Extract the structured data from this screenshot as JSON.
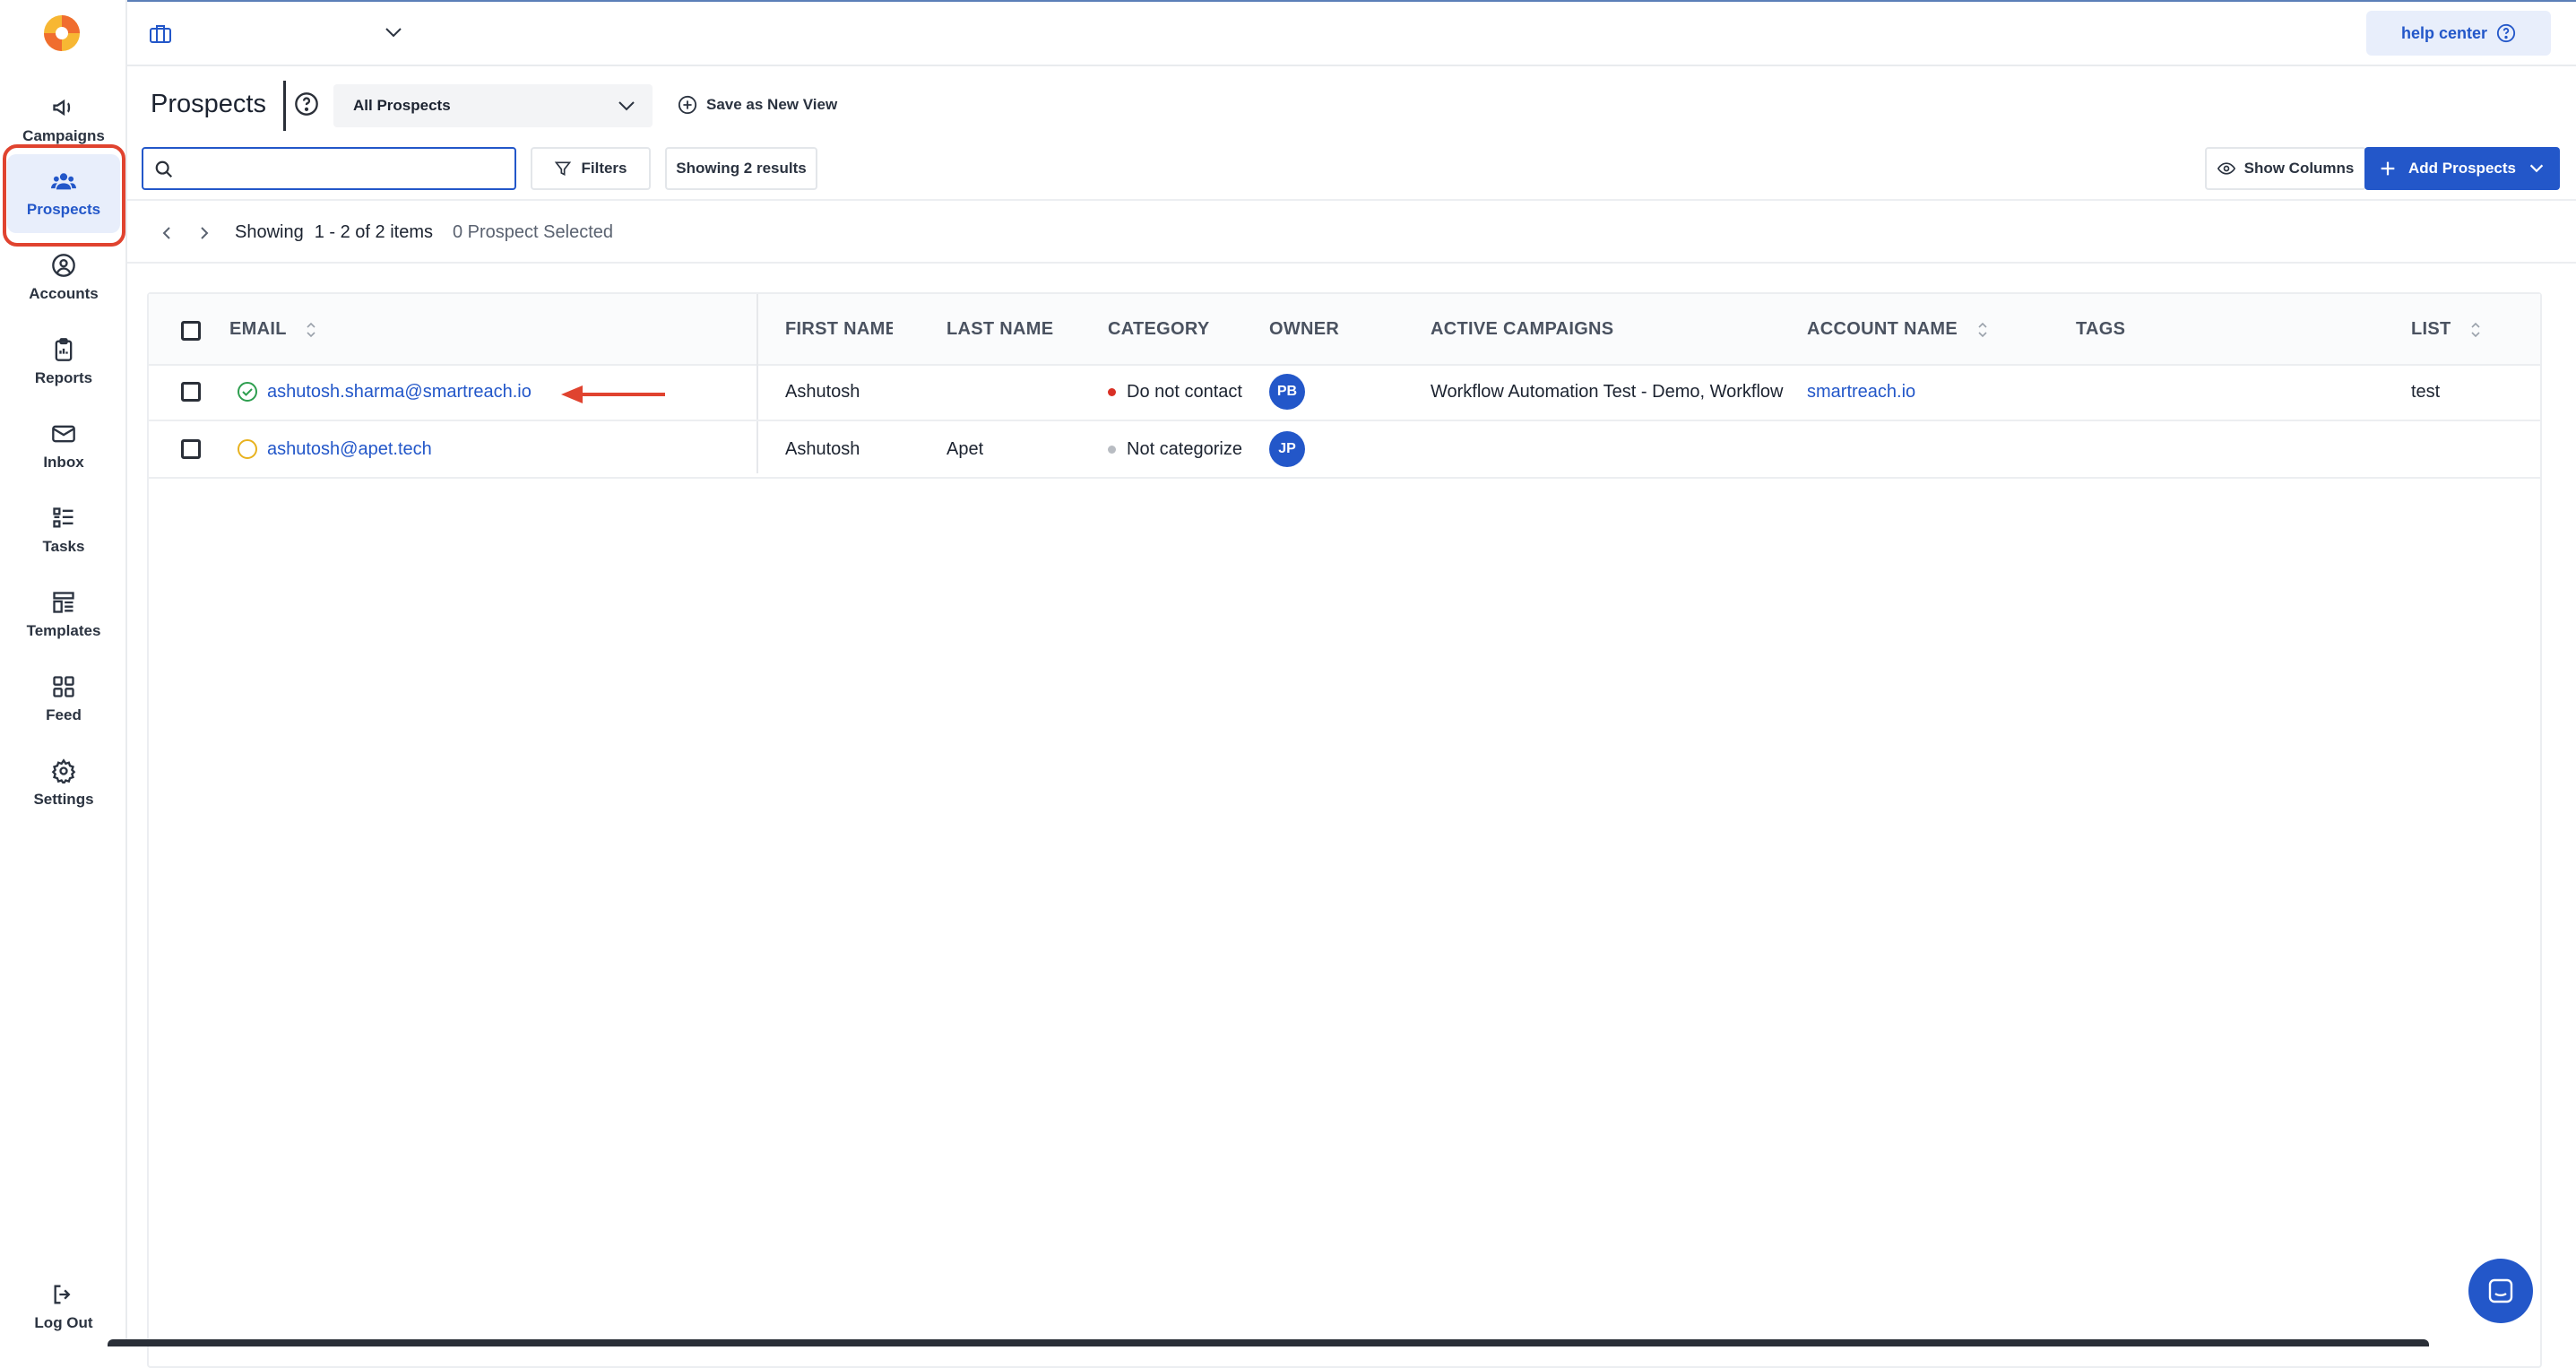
{
  "sidebar": {
    "items": [
      {
        "label": "Campaigns",
        "icon": "megaphone-icon"
      },
      {
        "label": "Prospects",
        "icon": "users-icon",
        "active": true
      },
      {
        "label": "Accounts",
        "icon": "user-circle-icon"
      },
      {
        "label": "Reports",
        "icon": "clipboard-icon"
      },
      {
        "label": "Inbox",
        "icon": "mail-icon"
      },
      {
        "label": "Tasks",
        "icon": "task-list-icon"
      },
      {
        "label": "Templates",
        "icon": "template-icon"
      },
      {
        "label": "Feed",
        "icon": "grid-icon"
      },
      {
        "label": "Settings",
        "icon": "gear-icon"
      }
    ],
    "logout_label": "Log Out"
  },
  "header": {
    "help_label": "help center"
  },
  "page": {
    "title": "Prospects",
    "view_selected": "All Prospects",
    "save_view_label": "Save as New View"
  },
  "toolbar": {
    "search_value": "",
    "filters_label": "Filters",
    "results_label": "Showing 2 results",
    "show_columns_label": "Show Columns",
    "add_prospects_label": "Add Prospects"
  },
  "pagination": {
    "showing_prefix": "Showing",
    "range_text": "1 - 2 of 2 items",
    "selected_text": "0 Prospect Selected"
  },
  "table": {
    "columns": [
      "EMAIL",
      "FIRST NAME",
      "LAST NAME",
      "CATEGORY",
      "OWNER",
      "ACTIVE CAMPAIGNS",
      "ACCOUNT NAME",
      "TAGS",
      "LIST"
    ],
    "rows": [
      {
        "email": "ashutosh.sharma@smartreach.io",
        "status": "verified",
        "first_name": "Ashutosh",
        "last_name": "",
        "category": "Do not contact",
        "category_color": "#d93025",
        "owner": "PB",
        "active_campaigns": "Workflow Automation Test - Demo, Workflow",
        "account_name": "smartreach.io",
        "tags": "",
        "list": "test"
      },
      {
        "email": "ashutosh@apet.tech",
        "status": "pending",
        "first_name": "Ashutosh",
        "last_name": "Apet",
        "category": "Not categorized",
        "category_color": "#b8bcc2",
        "owner": "JP",
        "active_campaigns": "",
        "account_name": "",
        "tags": "",
        "list": ""
      }
    ]
  },
  "colors": {
    "accent": "#2357c9",
    "highlight_ring": "#e0432f"
  }
}
